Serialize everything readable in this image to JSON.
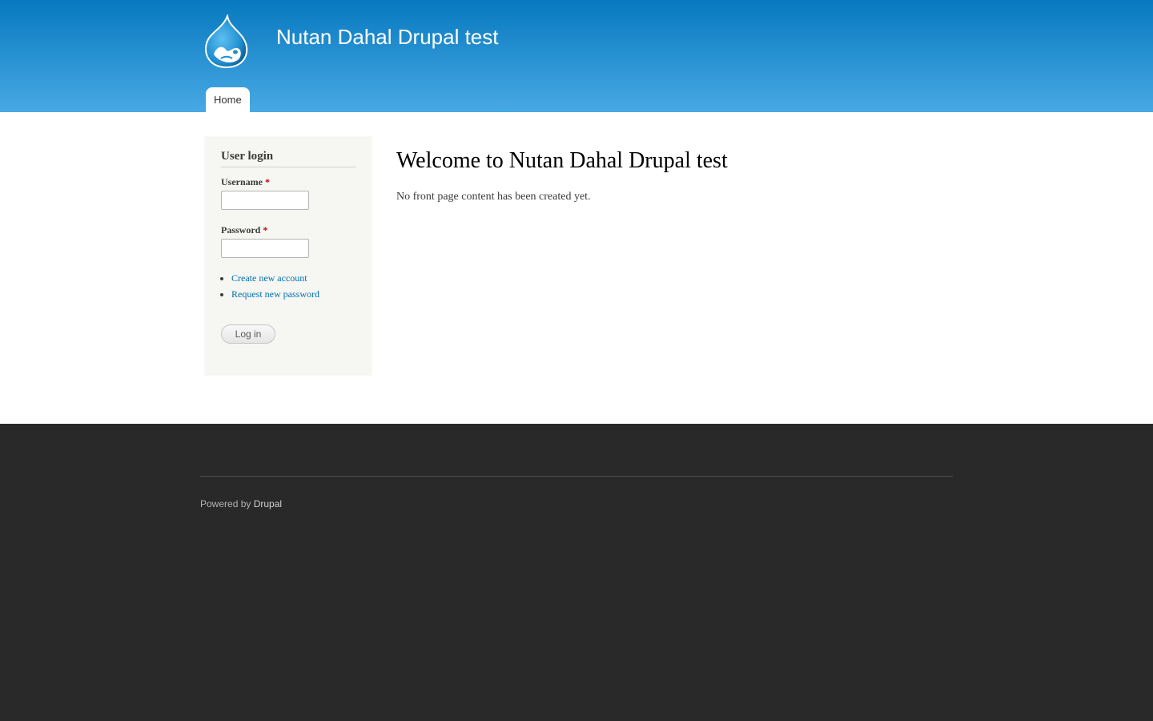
{
  "header": {
    "site_name": "Nutan Dahal Drupal test",
    "logo_icon": "drupal-drop-icon",
    "menu": [
      {
        "label": "Home",
        "active": true
      }
    ]
  },
  "sidebar": {
    "block_title": "User login",
    "username_label": "Username",
    "password_label": "Password",
    "required_marker": "*",
    "username_value": "",
    "password_value": "",
    "links": [
      {
        "label": "Create new account"
      },
      {
        "label": "Request new password"
      }
    ],
    "submit_label": "Log in"
  },
  "content": {
    "title": "Welcome to Nutan Dahal Drupal test",
    "message": "No front page content has been created yet."
  },
  "footer": {
    "powered_prefix": "Powered by",
    "powered_link": "Drupal"
  },
  "colors": {
    "header_top": "#0779bf",
    "header_bottom": "#48a9e4",
    "link": "#0071b3",
    "footer_bg": "#292929",
    "sidebar_bg": "#f6f6f2",
    "required": "#cc0000"
  }
}
